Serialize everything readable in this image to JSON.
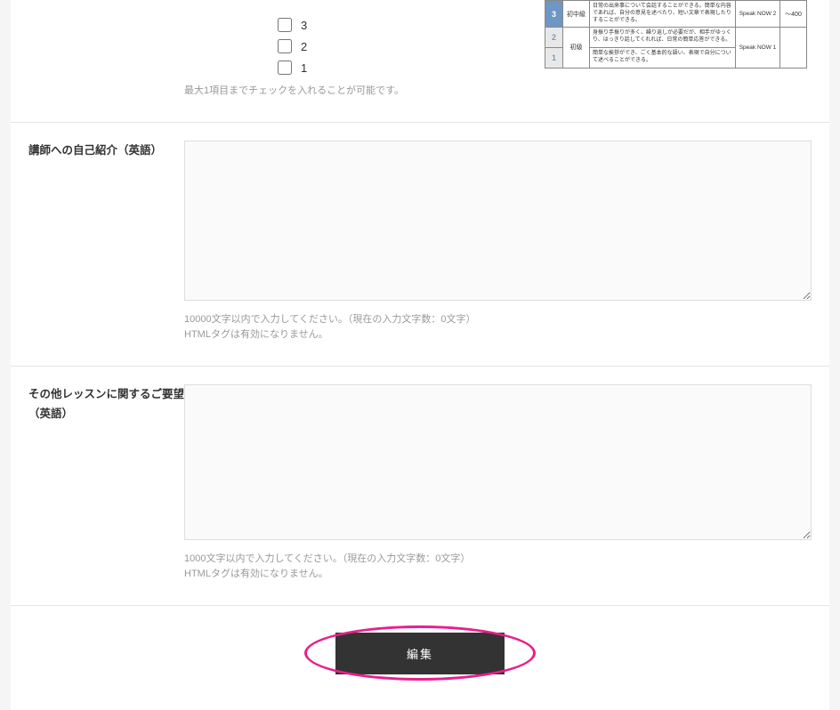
{
  "top": {
    "checkboxes": [
      "3",
      "2",
      "1"
    ],
    "helper": "最大1項目までチェックを入れることが可能です。",
    "level_table": {
      "rows": [
        {
          "num": "3",
          "num_class": "blue",
          "cat": "初中級",
          "desc": "日常の出来事について会話することができる。簡単な内容であれば、自分の意見を述べたり、短い文章で表現したりすることができる。",
          "speak": "Speak NOW 2",
          "score": "～400"
        },
        {
          "num": "2",
          "num_class": "",
          "cat_rowspan": true,
          "cat": "初級",
          "desc": "身振り手振りが多く、繰り返しが必要だが、相手がゆっくり、はっきり話してくれれば、日常の簡単応答ができる。",
          "speak": "Speak NOW 1",
          "score": ""
        },
        {
          "num": "1",
          "num_class": "",
          "desc": "簡単な挨拶ができ、ごく基本的な語い、表現で自分について述べることができる。",
          "speak": "",
          "score": ""
        }
      ]
    }
  },
  "intro": {
    "label": "講師への自己紹介（英語）",
    "helper1": "10000文字以内で入力してください。（現在の入力文字数：0文字）",
    "helper2": "HTMLタグは有効になりません。"
  },
  "request": {
    "label": "その他レッスンに関するご要望（英語）",
    "helper1": "1000文字以内で入力してください。（現在の入力文字数：0文字）",
    "helper2": "HTMLタグは有効になりません。"
  },
  "button": {
    "label": "編集"
  }
}
